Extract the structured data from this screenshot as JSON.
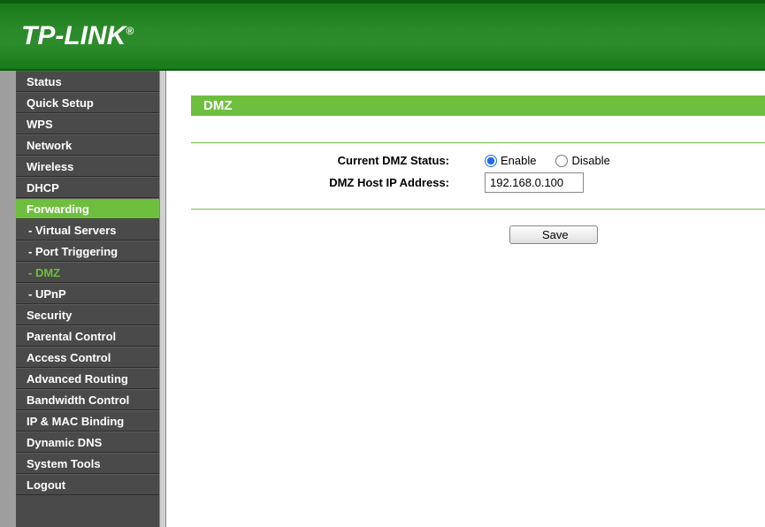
{
  "brand": "TP-LINK",
  "brand_reg": "®",
  "sidebar": {
    "items": [
      {
        "label": "Status"
      },
      {
        "label": "Quick Setup"
      },
      {
        "label": "WPS"
      },
      {
        "label": "Network"
      },
      {
        "label": "Wireless"
      },
      {
        "label": "DHCP"
      },
      {
        "label": "Forwarding",
        "active": true
      },
      {
        "label": "- Virtual Servers",
        "sub": true
      },
      {
        "label": "- Port Triggering",
        "sub": true
      },
      {
        "label": "- DMZ",
        "sub": true,
        "active_sub": true
      },
      {
        "label": "- UPnP",
        "sub": true
      },
      {
        "label": "Security"
      },
      {
        "label": "Parental Control"
      },
      {
        "label": "Access Control"
      },
      {
        "label": "Advanced Routing"
      },
      {
        "label": "Bandwidth Control"
      },
      {
        "label": "IP & MAC Binding"
      },
      {
        "label": "Dynamic DNS"
      },
      {
        "label": "System Tools"
      },
      {
        "label": "Logout"
      }
    ]
  },
  "page": {
    "title": "DMZ",
    "status_label": "Current DMZ Status:",
    "enable_label": "Enable",
    "disable_label": "Disable",
    "status_value": "enable",
    "host_label": "DMZ Host IP Address:",
    "host_value": "192.168.0.100",
    "save_label": "Save"
  }
}
